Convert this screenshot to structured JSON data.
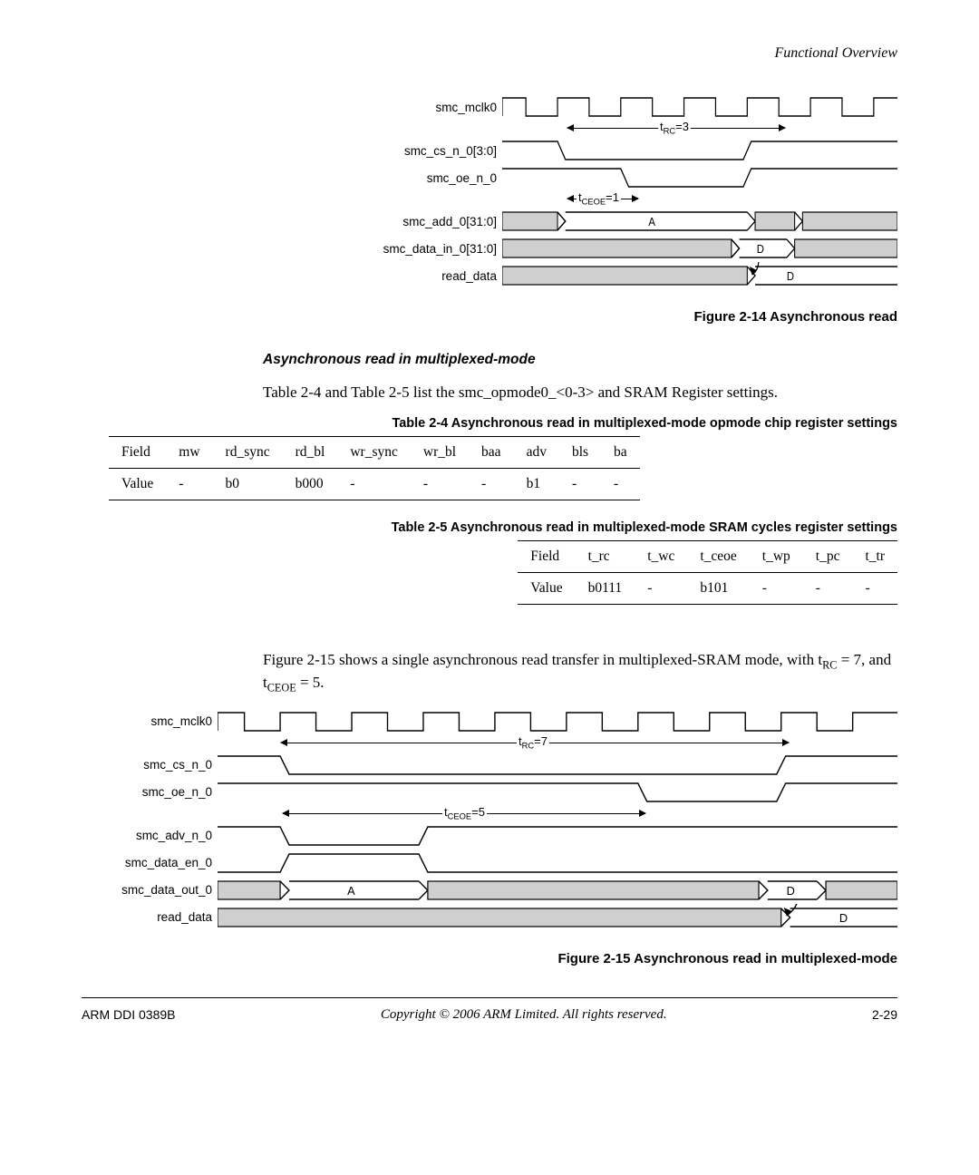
{
  "header": {
    "section": "Functional Overview"
  },
  "fig214": {
    "caption": "Figure 2-14 Asynchronous read",
    "signals": [
      "smc_mclk0",
      "smc_cs_n_0[3:0]",
      "smc_oe_n_0",
      "smc_add_0[31:0]",
      "smc_data_in_0[31:0]",
      "read_data"
    ],
    "annot_rc": "=3",
    "annot_rc_label": "t",
    "annot_rc_sub": "RC",
    "annot_ceoe": "=1",
    "annot_ceoe_label": "t",
    "annot_ceoe_sub": "CEOE",
    "bus_A": "A",
    "bus_D": "D",
    "bus_D2": "D"
  },
  "sec": {
    "heading": "Asynchronous read in multiplexed-mode",
    "body1a": "Table 2-4 and Table 2-5 list the smc_opmode0_<0-3> and SRAM Register settings."
  },
  "tbl24": {
    "caption": "Table 2-4 Asynchronous read in multiplexed-mode opmode chip register settings",
    "head": [
      "Field",
      "mw",
      "rd_sync",
      "rd_bl",
      "wr_sync",
      "wr_bl",
      "baa",
      "adv",
      "bls",
      "ba"
    ],
    "row": [
      "Value",
      "-",
      "b0",
      "b000",
      "-",
      "-",
      "-",
      "b1",
      "-",
      "-"
    ]
  },
  "tbl25": {
    "caption": "Table 2-5 Asynchronous read in multiplexed-mode SRAM cycles register settings",
    "head": [
      "Field",
      "t_rc",
      "t_wc",
      "t_ceoe",
      "t_wp",
      "t_pc",
      "t_tr"
    ],
    "row": [
      "Value",
      "b0111",
      "-",
      "b101",
      "-",
      "-",
      "-"
    ]
  },
  "para2": {
    "prefix": "Figure 2-15 shows a single asynchronous read transfer in multiplexed-SRAM mode, with t",
    "sub1": "RC",
    "mid": " = 7, and t",
    "sub2": "CEOE",
    "suffix": " = 5."
  },
  "fig215": {
    "caption": "Figure 2-15 Asynchronous read in multiplexed-mode",
    "signals": [
      "smc_mclk0",
      "smc_cs_n_0",
      "smc_oe_n_0",
      "smc_adv_n_0",
      "smc_data_en_0",
      "smc_data_out_0",
      "read_data"
    ],
    "annot_rc": "=7",
    "annot_rc_label": "t",
    "annot_rc_sub": "RC",
    "annot_ceoe": "=5",
    "annot_ceoe_label": "t",
    "annot_ceoe_sub": "CEOE",
    "bus_A": "A",
    "bus_D": "D",
    "bus_D2": "D"
  },
  "footer": {
    "left": "ARM DDI 0389B",
    "center": "Copyright © 2006 ARM Limited. All rights reserved.",
    "right": "2-29"
  }
}
